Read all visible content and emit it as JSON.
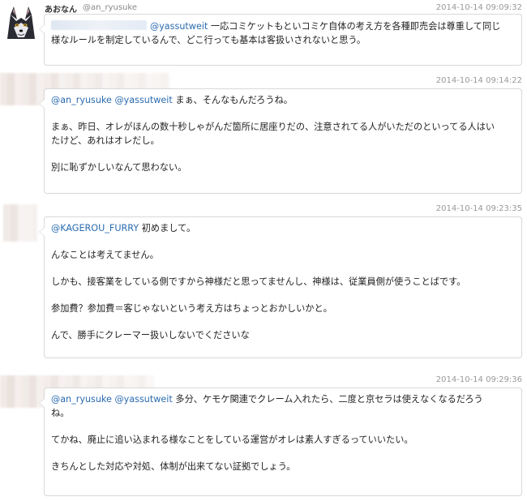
{
  "tweets": [
    {
      "name": "あおなん",
      "handle": "@an_ryusuke",
      "timestamp": "2014-10-14 09:09:32",
      "mentions": "@yassutweit",
      "lines": [
        "一応コミケットもといコミケ自体の考え方を各種即売会は尊重して同じ",
        "様なルールを制定しているんで、どこ行っても基本は客扱いされないと思う。"
      ]
    },
    {
      "timestamp": "2014-10-14 09:14:22",
      "mentions": "@an_ryusuke @yassutweit",
      "first": "まぁ、そんなもんだろうね。",
      "p2a": "まぁ、昨日、オレがほんの数十秒しゃがんだ箇所に居座りだの、注意されてる人がいただのといってる人はい",
      "p2b": "たけど、あれはオレだし。",
      "p3": "別に恥ずかしいなんて思わない。"
    },
    {
      "timestamp": "2014-10-14 09:23:35",
      "mentions": "@KAGEROU_FURRY",
      "first": "初めまして。",
      "p2": "んなことは考えてません。",
      "p3": "しかも、接客業をしている側ですから神様だと思ってませんし、神様は、従業員側が使うことばです。",
      "p4": "参加費？参加費＝客じゃないという考え方はちょっとおかしいかと。",
      "p5": "んで、勝手にクレーマー扱いしないでくださいな"
    },
    {
      "timestamp": "2014-10-14 09:29:36",
      "mentions": "@an_ryusuke @yassutweit",
      "first": "多分、ケモケ関連でクレーム入れたら、二度と京セラは使えなくなるだろう",
      "firstb": "ね。",
      "p2": "てかね、廃止に追い込まれる様なことをしている運営がオレは素人すぎるっていいたい。",
      "p3": "きちんとした対応や対処、体制が出来てない証拠でしょう。"
    }
  ],
  "colors": {
    "mention": "#2b6cb0",
    "border": "#d9d9d9",
    "timestamp": "#999999"
  }
}
